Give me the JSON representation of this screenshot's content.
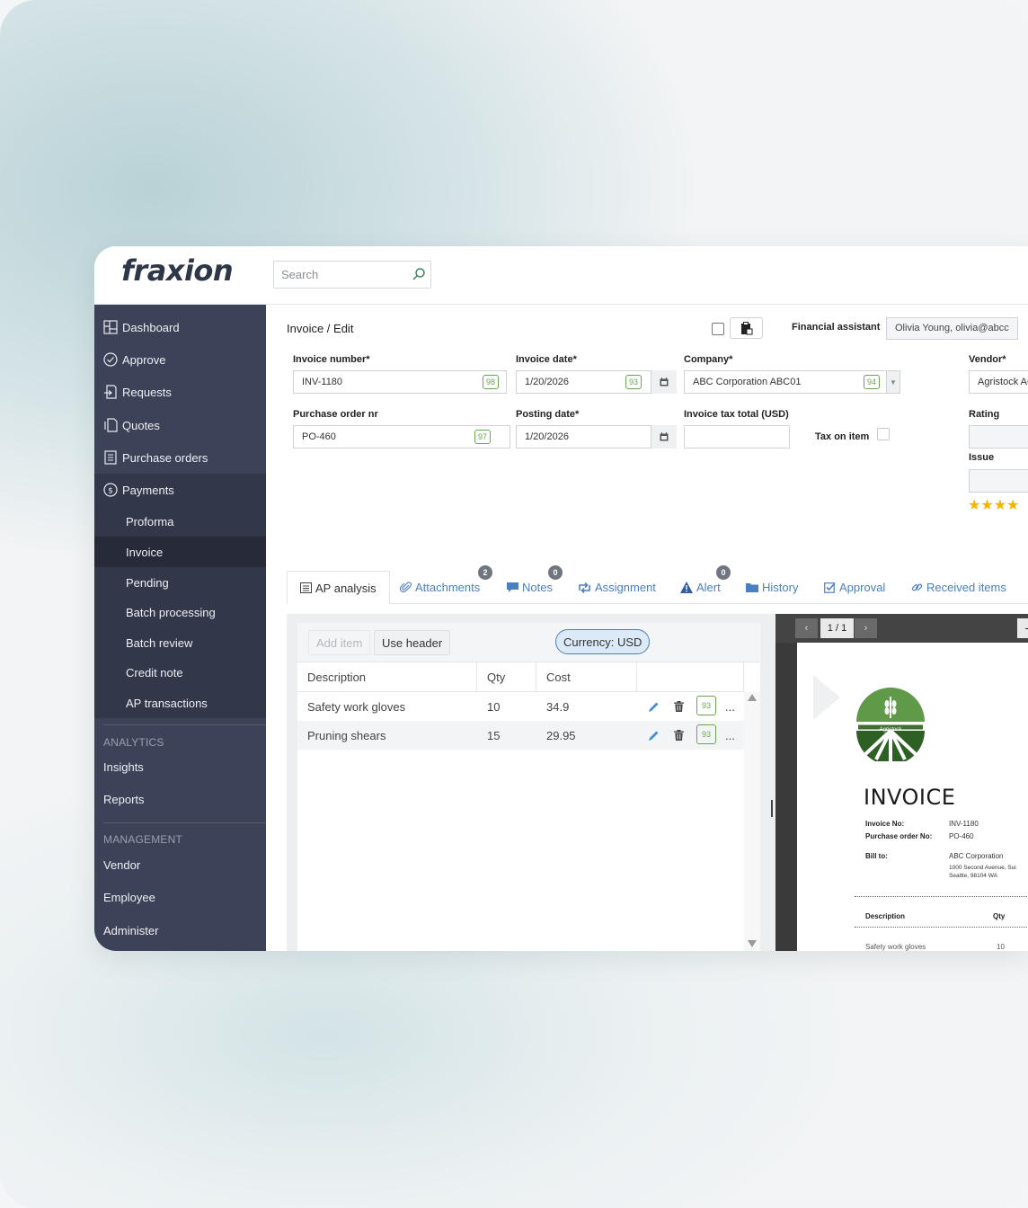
{
  "app": {
    "logo": "fraxion",
    "search_placeholder": "Search"
  },
  "sidebar": {
    "items": [
      {
        "label": "Dashboard",
        "icon": "dashboard-icon"
      },
      {
        "label": "Approve",
        "icon": "check-circle-icon"
      },
      {
        "label": "Requests",
        "icon": "request-icon"
      },
      {
        "label": "Quotes",
        "icon": "quotes-icon"
      },
      {
        "label": "Purchase orders",
        "icon": "document-list-icon"
      },
      {
        "label": "Payments",
        "icon": "dollar-circle-icon"
      }
    ],
    "payments_sub": [
      "Proforma",
      "Invoice",
      "Pending",
      "Batch processing",
      "Batch review",
      "Credit note",
      "AP transactions"
    ],
    "analytics_label": "ANALYTICS",
    "analytics": [
      "Insights",
      "Reports"
    ],
    "management_label": "MANAGEMENT",
    "management": [
      "Vendor",
      "Employee",
      "Administer"
    ]
  },
  "header": {
    "breadcrumb": "Invoice / Edit",
    "financial_assistant_label": "Financial assistant",
    "financial_assistant_value": "Olivia Young, olivia@abcc"
  },
  "form": {
    "invoice_number": {
      "label": "Invoice number*",
      "value": "INV-1180",
      "score": "98"
    },
    "invoice_date": {
      "label": "Invoice date*",
      "value": "1/20/2026",
      "score": "93"
    },
    "company": {
      "label": "Company*",
      "value": "ABC Corporation ABC01",
      "score": "94"
    },
    "vendor": {
      "label": "Vendor*",
      "value": "Agristock AG"
    },
    "purchase_order": {
      "label": "Purchase order nr",
      "value": "PO-460",
      "score": "97"
    },
    "posting_date": {
      "label": "Posting date*",
      "value": "1/20/2026"
    },
    "tax_total": {
      "label": "Invoice tax total (USD)",
      "value": ""
    },
    "tax_on_item": {
      "label": "Tax on item"
    },
    "rating": {
      "label": "Rating",
      "stars": 4,
      "stars_text": "★★★★"
    },
    "issue": {
      "label": "Issue"
    }
  },
  "tabs": [
    {
      "label": "AP analysis",
      "icon": "list-icon"
    },
    {
      "label": "Attachments",
      "icon": "paperclip-icon",
      "count": "2"
    },
    {
      "label": "Notes",
      "icon": "comment-icon",
      "count": "0"
    },
    {
      "label": "Assignment",
      "icon": "retweet-icon"
    },
    {
      "label": "Alert",
      "icon": "warning-icon",
      "count": "0"
    },
    {
      "label": "History",
      "icon": "folder-icon"
    },
    {
      "label": "Approval",
      "icon": "checkbox-icon"
    },
    {
      "label": "Received items",
      "icon": "link-icon"
    }
  ],
  "items_toolbar": {
    "add_item": "Add item",
    "use_header": "Use header",
    "currency": "Currency: USD"
  },
  "table": {
    "columns": [
      "Description",
      "Qty",
      "Cost"
    ],
    "rows": [
      {
        "description": "Safety work gloves",
        "qty": "10",
        "cost": "34.9",
        "score": "93",
        "more": "..."
      },
      {
        "description": "Pruning shears",
        "qty": "15",
        "cost": "29.95",
        "score": "93",
        "more": "..."
      }
    ]
  },
  "viewer": {
    "page_indicator": "1 / 1",
    "prev": "‹",
    "next": "›",
    "zoom_out": "−",
    "doc": {
      "logo_text": "Agristock",
      "title": "INVOICE",
      "invoice_no_label": "Invoice No:",
      "invoice_no": "INV-1180",
      "po_label": "Purchase order No:",
      "po": "PO-460",
      "bill_to_label": "Bill to:",
      "bill_to_name": "ABC Corporation",
      "bill_to_addr1": "1000 Second Avenue, Sui",
      "bill_to_addr2": "Seattle, 98104 WA",
      "col_description": "Description",
      "col_qty": "Qty",
      "line1_desc": "Safety work gloves",
      "line1_qty": "10"
    }
  }
}
